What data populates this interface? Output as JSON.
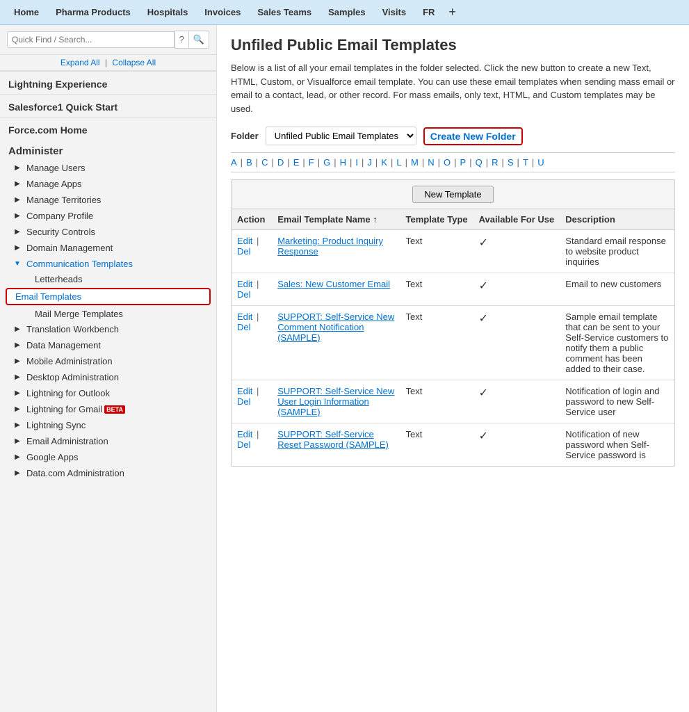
{
  "topnav": {
    "items": [
      {
        "label": "Home"
      },
      {
        "label": "Pharma Products"
      },
      {
        "label": "Hospitals"
      },
      {
        "label": "Invoices"
      },
      {
        "label": "Sales Teams"
      },
      {
        "label": "Samples"
      },
      {
        "label": "Visits"
      },
      {
        "label": "FR"
      },
      {
        "label": "+"
      }
    ]
  },
  "sidebar": {
    "search_placeholder": "Quick Find / Search...",
    "expand_label": "Expand All",
    "collapse_label": "Collapse All",
    "sections": [
      {
        "label": "Lightning Experience",
        "type": "section"
      },
      {
        "label": "Salesforce1 Quick Start",
        "type": "section"
      },
      {
        "label": "Force.com Home",
        "type": "section"
      },
      {
        "label": "Administer",
        "type": "administer"
      }
    ],
    "admin_items": [
      {
        "label": "Manage Users",
        "arrow": "right"
      },
      {
        "label": "Manage Apps",
        "arrow": "right"
      },
      {
        "label": "Manage Territories",
        "arrow": "right"
      },
      {
        "label": "Company Profile",
        "arrow": "right"
      },
      {
        "label": "Security Controls",
        "arrow": "right"
      },
      {
        "label": "Domain Management",
        "arrow": "right"
      },
      {
        "label": "Communication Templates",
        "arrow": "down",
        "open": true
      },
      {
        "label": "Translation Workbench",
        "arrow": "right"
      },
      {
        "label": "Data Management",
        "arrow": "right"
      },
      {
        "label": "Mobile Administration",
        "arrow": "right"
      },
      {
        "label": "Desktop Administration",
        "arrow": "right"
      },
      {
        "label": "Lightning for Outlook",
        "arrow": "right"
      },
      {
        "label": "Lightning for Gmail",
        "arrow": "right",
        "beta": true
      },
      {
        "label": "Lightning Sync",
        "arrow": "right"
      },
      {
        "label": "Email Administration",
        "arrow": "right"
      },
      {
        "label": "Google Apps",
        "arrow": "right"
      },
      {
        "label": "Data.com Administration",
        "arrow": "right"
      }
    ],
    "comm_template_sub": [
      {
        "label": "Letterheads"
      },
      {
        "label": "Email Templates",
        "active": true
      },
      {
        "label": "Mail Merge Templates"
      }
    ]
  },
  "content": {
    "title": "Unfiled Public Email Templates",
    "description": "Below is a list of all your email templates in the folder selected. Click the new button to create a new Text, HTML, Custom, or Visualforce email template. You can use these email templates when sending mass email or email to a contact, lead, or other record. For mass emails, only text, HTML, and Custom templates may be used.",
    "folder_label": "Folder",
    "folder_value": "Unfiled Public Email Templates",
    "create_folder_label": "Create New Folder",
    "alpha_letters": [
      "A",
      "B",
      "C",
      "D",
      "E",
      "F",
      "G",
      "H",
      "I",
      "J",
      "K",
      "L",
      "M",
      "N",
      "O",
      "P",
      "Q",
      "R",
      "S",
      "T",
      "U"
    ],
    "new_template_label": "New Template",
    "table_headers": [
      "Action",
      "Email Template Name ↑",
      "Template Type",
      "Available For Use",
      "Description"
    ],
    "table_rows": [
      {
        "actions": [
          "Edit",
          "Del"
        ],
        "name": "Marketing: Product Inquiry Response",
        "type": "Text",
        "available": true,
        "description": "Standard email response to website product inquiries"
      },
      {
        "actions": [
          "Edit",
          "Del"
        ],
        "name": "Sales: New Customer Email",
        "type": "Text",
        "available": true,
        "description": "Email to new customers"
      },
      {
        "actions": [
          "Edit",
          "Del"
        ],
        "name": "SUPPORT: Self-Service New Comment Notification (SAMPLE)",
        "type": "Text",
        "available": true,
        "description": "Sample email template that can be sent to your Self-Service customers to notify them a public comment has been added to their case."
      },
      {
        "actions": [
          "Edit",
          "Del"
        ],
        "name": "SUPPORT: Self-Service New User Login Information (SAMPLE)",
        "type": "Text",
        "available": true,
        "description": "Notification of login and password to new Self-Service user"
      },
      {
        "actions": [
          "Edit",
          "Del"
        ],
        "name": "SUPPORT: Self-Service Reset Password (SAMPLE)",
        "type": "Text",
        "available": true,
        "description": "Notification of new password when Self-Service password is"
      }
    ]
  }
}
